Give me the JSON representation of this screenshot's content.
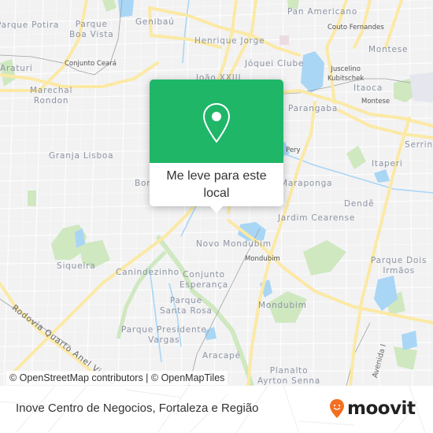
{
  "map": {
    "neighborhoods": [
      {
        "id": "parque-potira",
        "text": "Parque Potira"
      },
      {
        "id": "parque-boa-vista",
        "text": "Parque\nBoa Vista"
      },
      {
        "id": "genibau",
        "text": "Genibaú"
      },
      {
        "id": "henrique-jorge",
        "text": "Henrique Jorge"
      },
      {
        "id": "pan-americano",
        "text": "Pan Americano"
      },
      {
        "id": "araturi",
        "text": "Araturi"
      },
      {
        "id": "joquei-clube",
        "text": "Jóquei Clube"
      },
      {
        "id": "montese",
        "text": "Montese"
      },
      {
        "id": "marechal-rondon",
        "text": "Marechal\nRondon"
      },
      {
        "id": "joao-xxiii",
        "text": "João XXIII"
      },
      {
        "id": "itaoca",
        "text": "Itaoca"
      },
      {
        "id": "parangaba",
        "text": "Parangaba"
      },
      {
        "id": "serrinha",
        "text": "Serrinha"
      },
      {
        "id": "granja-lisboa",
        "text": "Granja Lisboa"
      },
      {
        "id": "vila-pery",
        "text": "Pery"
      },
      {
        "id": "itaperi",
        "text": "Itaperi"
      },
      {
        "id": "bom-jardim",
        "text": "Bor"
      },
      {
        "id": "maraponga",
        "text": "Maraponga"
      },
      {
        "id": "dende",
        "text": "Dendê"
      },
      {
        "id": "jardim-cearense",
        "text": "Jardim Cearense"
      },
      {
        "id": "novo-mondubim",
        "text": "Novo Mondubim"
      },
      {
        "id": "siqueira",
        "text": "Siqueira"
      },
      {
        "id": "parque-dois-irmaos",
        "text": "Parque Dois\nIrmãos"
      },
      {
        "id": "canindezinho",
        "text": "Canindezinho"
      },
      {
        "id": "conjunto-esperanca",
        "text": "Conjunto\nEsperança"
      },
      {
        "id": "parque-santa-rosa",
        "text": "Parque\nSanta Rosa"
      },
      {
        "id": "mondubim",
        "text": "Mondubim"
      },
      {
        "id": "parque-presidente-vargas",
        "text": "Parque Presidente\nVargas"
      },
      {
        "id": "aracape",
        "text": "Aracapé"
      },
      {
        "id": "planalto-ayrton-senna",
        "text": "Planalto\nAyrton Senna"
      }
    ],
    "stations": [
      {
        "id": "conjunto-ceara",
        "text": "Conjunto Ceará"
      },
      {
        "id": "couto-fernandes",
        "text": "Couto Fernandes"
      },
      {
        "id": "juscelino-kubitschek",
        "text": "Juscelino\nKubitschek"
      },
      {
        "id": "montese-station",
        "text": "Montese"
      },
      {
        "id": "mondubim-station",
        "text": "Mondubim"
      }
    ],
    "roads": [
      {
        "id": "rodovia-quarto-anel",
        "text": "Rodovia Quarto Anel Viário"
      },
      {
        "id": "avenida-i",
        "text": "Avenida I"
      }
    ],
    "attribution": "© OpenStreetMap contributors | © OpenMapTiles"
  },
  "popup": {
    "icon": "map-pin-icon",
    "action_label": "Me leve para este local"
  },
  "footer": {
    "title": "Inove Centro de Negocios, Fortaleza e Região",
    "brand": "moovit",
    "brand_color": "#f36f21"
  },
  "colors": {
    "popup_green": "#1fb668",
    "major_road": "#fbe9a5",
    "water": "#a9d6f5",
    "park": "#cfe8c0",
    "land": "#f2f2f3"
  }
}
